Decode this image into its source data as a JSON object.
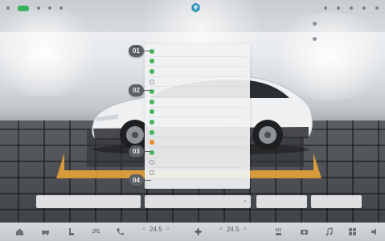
{
  "status_bar": {
    "left_items": [
      "wifi-icon",
      "signal-badge",
      "bluetooth-icon",
      "location-icon",
      "profile-icon"
    ],
    "right_items": [
      "user-icon",
      "notification-icon",
      "settings-icon",
      "network-status",
      "clock"
    ]
  },
  "settings_panel": {
    "rows": [
      {
        "indicator": "on",
        "label": "",
        "value": ""
      },
      {
        "indicator": "on",
        "label": "",
        "value": ""
      },
      {
        "indicator": "on",
        "label": "",
        "value": ""
      },
      {
        "indicator": "off",
        "label": "",
        "value": ""
      },
      {
        "indicator": "on",
        "label": "",
        "value": ""
      },
      {
        "indicator": "on",
        "label": "",
        "value": ""
      },
      {
        "indicator": "on",
        "label": "",
        "value": ""
      },
      {
        "indicator": "on",
        "label": "",
        "value": ""
      },
      {
        "indicator": "on",
        "label": "",
        "value": ""
      },
      {
        "indicator": "warn",
        "label": "",
        "value": ""
      },
      {
        "indicator": "on",
        "label": "",
        "value": ""
      },
      {
        "indicator": "off",
        "label": "",
        "value": ""
      },
      {
        "indicator": "off",
        "label": "",
        "value": ""
      }
    ]
  },
  "callouts": [
    "01",
    "02",
    "03",
    "04"
  ],
  "buttons": [
    {
      "label": ""
    },
    {
      "label": ""
    },
    {
      "label": ""
    },
    {
      "label": ""
    }
  ],
  "dock": {
    "left_temp": "24.5",
    "right_temp": "24.5",
    "arrow_left": "<",
    "arrow_right": ">"
  },
  "colors": {
    "accent_green": "#3fb65c",
    "warning_orange": "#f08a2c",
    "parking_yellow": "#e8a33a",
    "callout_gray": "#5c5f63"
  }
}
